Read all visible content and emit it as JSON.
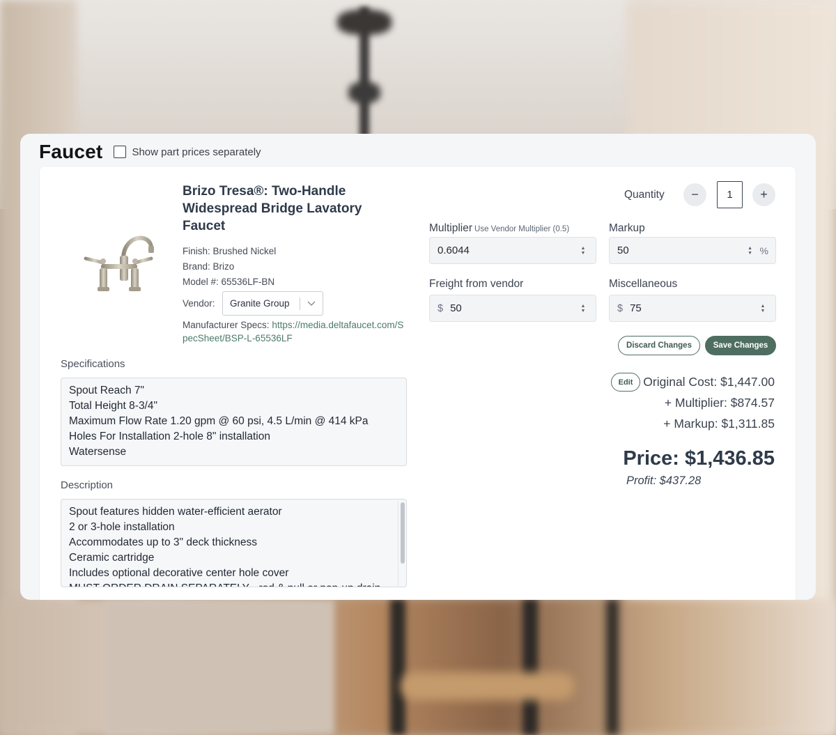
{
  "header": {
    "title": "Faucet",
    "show_parts_label": "Show part prices separately"
  },
  "product": {
    "title": "Brizo Tresa®: Two-Handle Widespread Bridge Lavatory Faucet",
    "finish": "Finish: Brushed Nickel",
    "brand": "Brand: Brizo",
    "model": "Model #: 65536LF-BN",
    "vendor_label": "Vendor:",
    "vendor_value": "Granite Group",
    "specs_label": "Manufacturer Specs:",
    "specs_url": "https://media.deltafaucet.com/SpecSheet/BSP-L-65536LF"
  },
  "specifications": {
    "label": "Specifications",
    "lines": [
      "Spout Reach 7\"",
      "Total Height 8-3/4\"",
      "Maximum Flow Rate 1.20 gpm @ 60 psi, 4.5 L/min @ 414 kPa",
      "Holes For Installation 2-hole 8\" installation",
      "Watersense"
    ]
  },
  "description": {
    "label": "Description",
    "lines": [
      "Spout features hidden water-efficient aerator",
      "2 or 3-hole installation",
      "Accommodates up to 3\" deck thickness",
      "Ceramic cartridge",
      "Includes optional decorative center hole cover",
      "MUST ORDER DRAIN SEPARATELY - rod & pull or pop-up drain"
    ]
  },
  "quantity": {
    "label": "Quantity",
    "minus": "−",
    "plus": "+",
    "value": "1"
  },
  "fields": {
    "multiplier_label": "Multiplier",
    "multiplier_hint": "Use Vendor Multiplier (0.5)",
    "multiplier_value": "0.6044",
    "markup_label": "Markup",
    "markup_value": "50",
    "markup_suffix": "%",
    "freight_label": "Freight from vendor",
    "freight_prefix": "$",
    "freight_value": "50",
    "misc_label": "Miscellaneous",
    "misc_prefix": "$",
    "misc_value": "75"
  },
  "actions": {
    "discard": "Discard Changes",
    "save": "Save Changes",
    "edit": "Edit"
  },
  "summary": {
    "original_cost": "Original Cost: $1,447.00",
    "multiplier": "+ Multiplier: $874.57",
    "markup": "+ Markup: $1,311.85",
    "price": "Price: $1,436.85",
    "profit": "Profit: $437.28"
  },
  "colors": {
    "accent": "#4f6e62",
    "title": "#2f3a4a"
  }
}
